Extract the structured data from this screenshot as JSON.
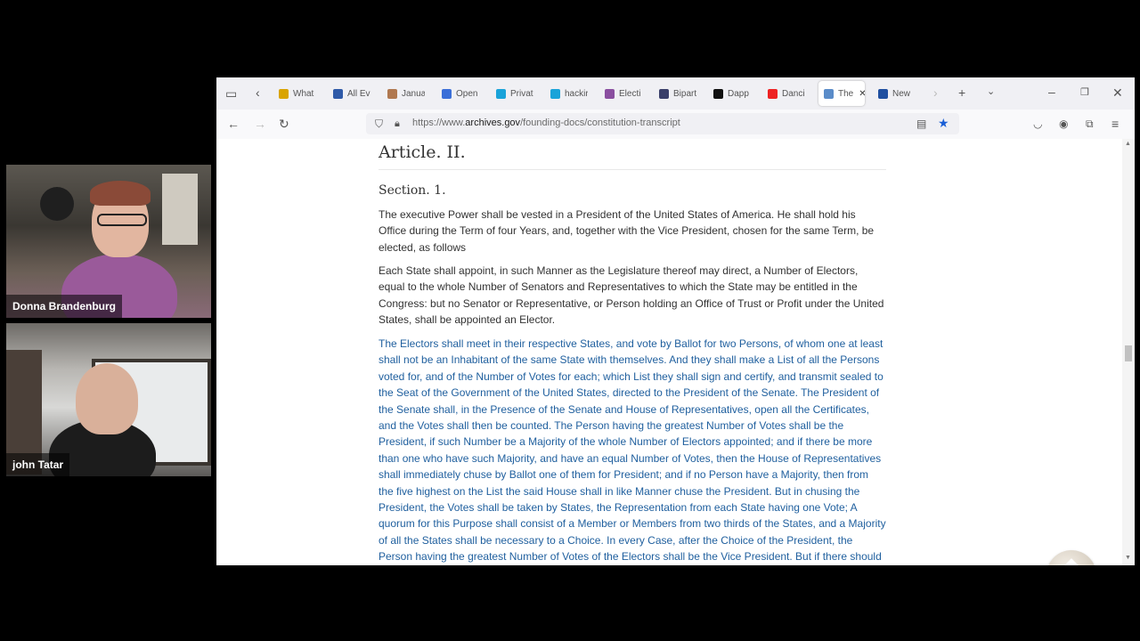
{
  "participants": [
    {
      "name": "Donna Brandenburg"
    },
    {
      "name": "john Tatar"
    }
  ],
  "browser": {
    "tabs": [
      {
        "label": "What",
        "icon": "norton-icon",
        "color": "#d9a400"
      },
      {
        "label": "All Ev",
        "icon": "l-icon",
        "color": "#2f5aa8"
      },
      {
        "label": "Janua",
        "icon": "avatar-icon",
        "color": "#b07850"
      },
      {
        "label": "Open",
        "icon": "refresh-c-icon",
        "color": "#3b6fd8"
      },
      {
        "label": "Privat",
        "icon": "v-icon",
        "color": "#1aa3d9"
      },
      {
        "label": "hackir",
        "icon": "v-icon",
        "color": "#1aa3d9"
      },
      {
        "label": "Electi",
        "icon": "seal-icon",
        "color": "#8a4fa0"
      },
      {
        "label": "Bipart",
        "icon": "news-icon",
        "color": "#3a3f6a"
      },
      {
        "label": "Dapp",
        "icon": "x-icon",
        "color": "#111111"
      },
      {
        "label": "Danci",
        "icon": "youtube-icon",
        "color": "#e22"
      },
      {
        "label": "The",
        "icon": "n-icon",
        "color": "#5a8cc9",
        "active": true
      },
      {
        "label": "New",
        "icon": "j-icon",
        "color": "#1f4fa0"
      }
    ],
    "url": {
      "domain_prefix": "https://www.",
      "domain": "archives.gov",
      "path": "/founding-docs/constitution-transcript"
    }
  },
  "doc": {
    "article": "Article. II.",
    "section": "Section. 1.",
    "p1": "The executive Power shall be vested in a President of the United States of America. He shall hold his Office during the Term of four Years, and, together with the Vice President, chosen for the same Term, be elected, as follows",
    "p2": "Each State shall appoint, in such Manner as the Legislature thereof may direct, a Number of Electors, equal to the whole Number of Senators and Representatives to which the State may be entitled in the Congress: but no Senator or Representative, or Person holding an Office of Trust or Profit under the United States, shall be appointed an Elector.",
    "p3": "The Electors shall meet in their respective States, and vote by Ballot for two Persons, of whom one at least shall not be an Inhabitant of the same State with themselves. And they shall make a List of all the Persons voted for, and of the Number of Votes for each; which List they shall sign and certify, and transmit sealed to the Seat of the Government of the United States, directed to the President of the Senate. The President of the Senate shall, in the Presence of the Senate and House of Representatives, open all the Certificates, and the Votes shall then be counted. The Person having the greatest Number of Votes shall be the President, if such Number be a Majority of the whole Number of Electors appointed; and if there be more than one who have such Majority, and have an equal Number of Votes, then the House of Representatives shall immediately chuse by Ballot one of them for President; and if no Person have a Majority, then from the five highest on the List the said House shall in like Manner chuse the President. But in chusing the President, the Votes shall be taken by States, the Representation from each State having one Vote; A quorum for this Purpose shall consist of a Member or Members from two thirds of the States, and a Majority of all the States shall be necessary to a Choice. In every Case, after the Choice of the President, the Person having the greatest Number of Votes of the Electors shall be the Vice President. But if there should remain two or"
  },
  "colors": {
    "link": "#1f5f9e",
    "star": "#1a5fd6"
  }
}
